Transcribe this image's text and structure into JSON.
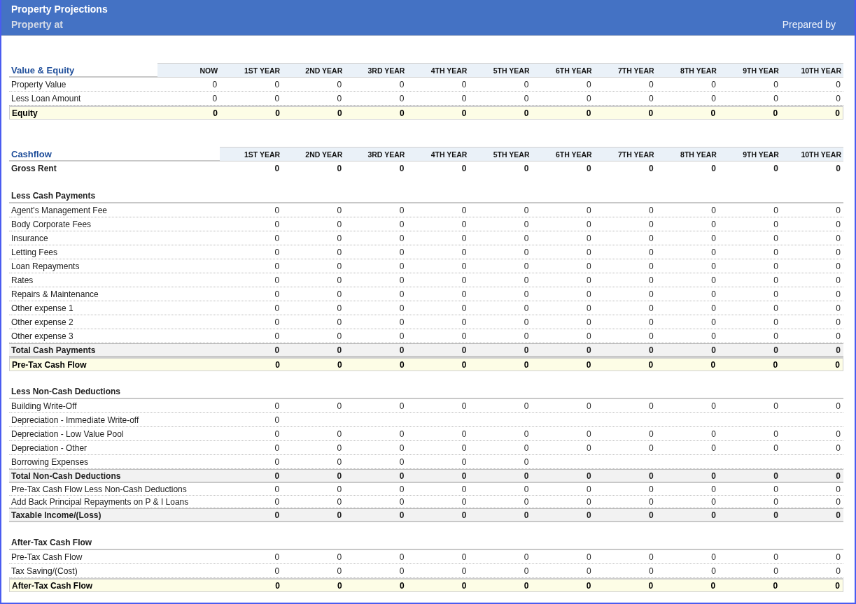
{
  "header": {
    "title": "Property Projections",
    "subtitle": "Property at",
    "prepared_by": "Prepared by"
  },
  "tables": [
    {
      "title": "Value & Equity",
      "columns": [
        "NOW",
        "1ST YEAR",
        "2ND YEAR",
        "3RD YEAR",
        "4TH YEAR",
        "5TH YEAR",
        "6TH YEAR",
        "7TH YEAR",
        "8TH YEAR",
        "9TH YEAR",
        "10TH YEAR"
      ],
      "rows": [
        {
          "kind": "item",
          "label": "Property Value",
          "values": [
            "0",
            "0",
            "0",
            "0",
            "0",
            "0",
            "0",
            "0",
            "0",
            "0",
            "0"
          ]
        },
        {
          "kind": "item",
          "label": "Less Loan Amount",
          "values": [
            "0",
            "0",
            "0",
            "0",
            "0",
            "0",
            "0",
            "0",
            "0",
            "0",
            "0"
          ]
        },
        {
          "kind": "highlight",
          "label": "Equity",
          "values": [
            "0",
            "0",
            "0",
            "0",
            "0",
            "0",
            "0",
            "0",
            "0",
            "0",
            "0"
          ]
        }
      ]
    },
    {
      "title": "Cashflow",
      "columns": [
        "1ST YEAR",
        "2ND YEAR",
        "3RD YEAR",
        "4TH YEAR",
        "5TH YEAR",
        "6TH YEAR",
        "7TH YEAR",
        "8TH YEAR",
        "9TH YEAR",
        "10TH YEAR"
      ],
      "rows": [
        {
          "kind": "bold",
          "label": "Gross Rent",
          "values": [
            "0",
            "0",
            "0",
            "0",
            "0",
            "0",
            "0",
            "0",
            "0",
            "0"
          ]
        },
        {
          "kind": "heading",
          "label": "Less Cash Payments"
        },
        {
          "kind": "item",
          "label": "Agent's Management Fee",
          "values": [
            "0",
            "0",
            "0",
            "0",
            "0",
            "0",
            "0",
            "0",
            "0",
            "0"
          ]
        },
        {
          "kind": "item",
          "label": "Body Corporate Fees",
          "values": [
            "0",
            "0",
            "0",
            "0",
            "0",
            "0",
            "0",
            "0",
            "0",
            "0"
          ]
        },
        {
          "kind": "item",
          "label": "Insurance",
          "values": [
            "0",
            "0",
            "0",
            "0",
            "0",
            "0",
            "0",
            "0",
            "0",
            "0"
          ]
        },
        {
          "kind": "item",
          "label": "Letting Fees",
          "values": [
            "0",
            "0",
            "0",
            "0",
            "0",
            "0",
            "0",
            "0",
            "0",
            "0"
          ]
        },
        {
          "kind": "item",
          "label": "Loan Repayments",
          "values": [
            "0",
            "0",
            "0",
            "0",
            "0",
            "0",
            "0",
            "0",
            "0",
            "0"
          ]
        },
        {
          "kind": "item",
          "label": "Rates",
          "values": [
            "0",
            "0",
            "0",
            "0",
            "0",
            "0",
            "0",
            "0",
            "0",
            "0"
          ]
        },
        {
          "kind": "item",
          "label": "Repairs & Maintenance",
          "values": [
            "0",
            "0",
            "0",
            "0",
            "0",
            "0",
            "0",
            "0",
            "0",
            "0"
          ]
        },
        {
          "kind": "item",
          "label": "Other expense 1",
          "values": [
            "0",
            "0",
            "0",
            "0",
            "0",
            "0",
            "0",
            "0",
            "0",
            "0"
          ]
        },
        {
          "kind": "item",
          "label": "Other expense 2",
          "values": [
            "0",
            "0",
            "0",
            "0",
            "0",
            "0",
            "0",
            "0",
            "0",
            "0"
          ]
        },
        {
          "kind": "item",
          "label": "Other expense 3",
          "values": [
            "0",
            "0",
            "0",
            "0",
            "0",
            "0",
            "0",
            "0",
            "0",
            "0"
          ]
        },
        {
          "kind": "total",
          "label": "Total Cash Payments",
          "values": [
            "0",
            "0",
            "0",
            "0",
            "0",
            "0",
            "0",
            "0",
            "0",
            "0"
          ]
        },
        {
          "kind": "highlight",
          "label": "Pre-Tax Cash Flow",
          "values": [
            "0",
            "0",
            "0",
            "0",
            "0",
            "0",
            "0",
            "0",
            "0",
            "0"
          ]
        },
        {
          "kind": "heading",
          "label": "Less Non-Cash Deductions"
        },
        {
          "kind": "item",
          "label": "Building Write-Off",
          "values": [
            "0",
            "0",
            "0",
            "0",
            "0",
            "0",
            "0",
            "0",
            "0",
            "0"
          ]
        },
        {
          "kind": "item",
          "label": "Depreciation - Immediate Write-off",
          "values": [
            "0"
          ]
        },
        {
          "kind": "item",
          "label": "Depreciation - Low Value Pool",
          "values": [
            "0",
            "0",
            "0",
            "0",
            "0",
            "0",
            "0",
            "0",
            "0",
            "0"
          ]
        },
        {
          "kind": "item",
          "label": "Depreciation - Other",
          "values": [
            "0",
            "0",
            "0",
            "0",
            "0",
            "0",
            "0",
            "0",
            "0",
            "0"
          ]
        },
        {
          "kind": "item",
          "label": "Borrowing Expenses",
          "values": [
            "0",
            "0",
            "0",
            "0",
            "0"
          ]
        },
        {
          "kind": "total",
          "label": "Total Non-Cash Deductions",
          "values": [
            "0",
            "0",
            "0",
            "0",
            "0",
            "0",
            "0",
            "0",
            "0",
            "0"
          ]
        },
        {
          "kind": "compact",
          "label": "Pre-Tax Cash Flow Less Non-Cash Deductions",
          "values": [
            "0",
            "0",
            "0",
            "0",
            "0",
            "0",
            "0",
            "0",
            "0",
            "0"
          ]
        },
        {
          "kind": "compact",
          "label": "Add Back Principal Repayments on P & I Loans",
          "values": [
            "0",
            "0",
            "0",
            "0",
            "0",
            "0",
            "0",
            "0",
            "0",
            "0"
          ]
        },
        {
          "kind": "total",
          "label": "Taxable Income/(Loss)",
          "values": [
            "0",
            "0",
            "0",
            "0",
            "0",
            "0",
            "0",
            "0",
            "0",
            "0"
          ]
        },
        {
          "kind": "heading",
          "label": "After-Tax Cash Flow"
        },
        {
          "kind": "item",
          "label": "Pre-Tax Cash Flow",
          "values": [
            "0",
            "0",
            "0",
            "0",
            "0",
            "0",
            "0",
            "0",
            "0",
            "0"
          ]
        },
        {
          "kind": "item",
          "label": "Tax Saving/(Cost)",
          "values": [
            "0",
            "0",
            "0",
            "0",
            "0",
            "0",
            "0",
            "0",
            "0",
            "0"
          ]
        },
        {
          "kind": "highlight",
          "label": "After-Tax Cash Flow",
          "values": [
            "0",
            "0",
            "0",
            "0",
            "0",
            "0",
            "0",
            "0",
            "0",
            "0"
          ]
        }
      ]
    }
  ]
}
